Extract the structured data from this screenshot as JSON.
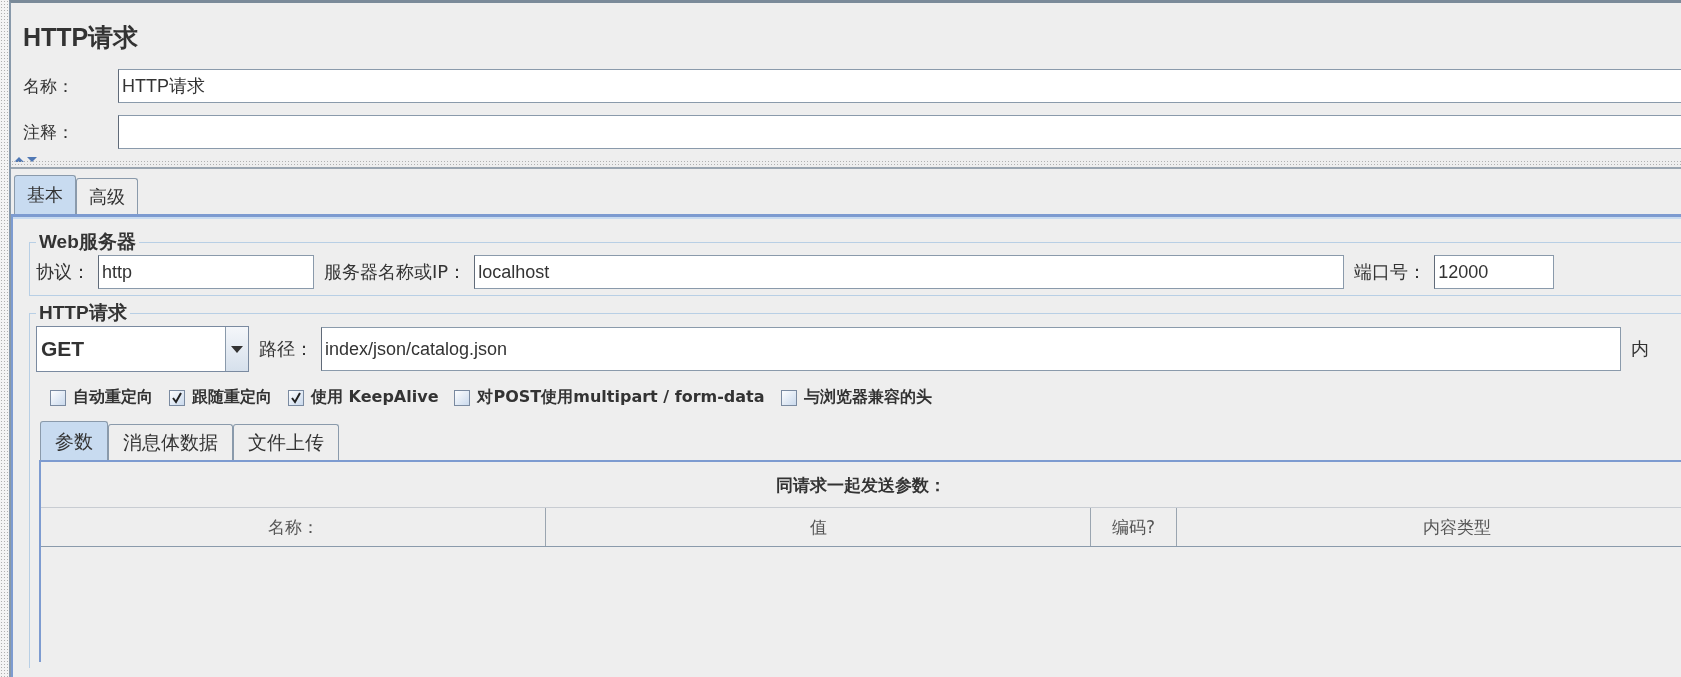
{
  "title": "HTTP请求",
  "fields": [
    {
      "label": "名称：",
      "value": "HTTP请求"
    },
    {
      "label": "注释："
    }
  ],
  "tabs": [
    {
      "label": "基本",
      "selected": true
    },
    {
      "label": "高级",
      "selected": false
    }
  ],
  "web_server": {
    "title": "Web服务器",
    "protocol": {
      "label": "协议：",
      "value": "http"
    },
    "server": {
      "label": "服务器名称或IP：",
      "value": "localhost"
    },
    "port": {
      "label": "端口号：",
      "value": "12000"
    }
  },
  "http_request": {
    "title": "HTTP请求",
    "method": {
      "value": "GET"
    },
    "path": {
      "label": "路径：",
      "value": "index/json/catalog.json"
    },
    "content_encoding_label": "内",
    "options": [
      {
        "label": "自动重定向",
        "checked": false
      },
      {
        "label": "跟随重定向",
        "checked": true
      },
      {
        "label": "使用 KeepAlive",
        "checked": true
      },
      {
        "label": "对POST使用multipart / form-data",
        "checked": false
      },
      {
        "label": "与浏览器兼容的头",
        "checked": false
      }
    ]
  },
  "body_tabs": [
    {
      "label": "参数",
      "selected": true
    },
    {
      "label": "消息体数据",
      "selected": false
    },
    {
      "label": "文件上传",
      "selected": false
    }
  ],
  "parameters": {
    "caption": "同请求一起发送参数：",
    "columns": [
      "名称：",
      "值",
      "编码?",
      "内容类型"
    ]
  }
}
